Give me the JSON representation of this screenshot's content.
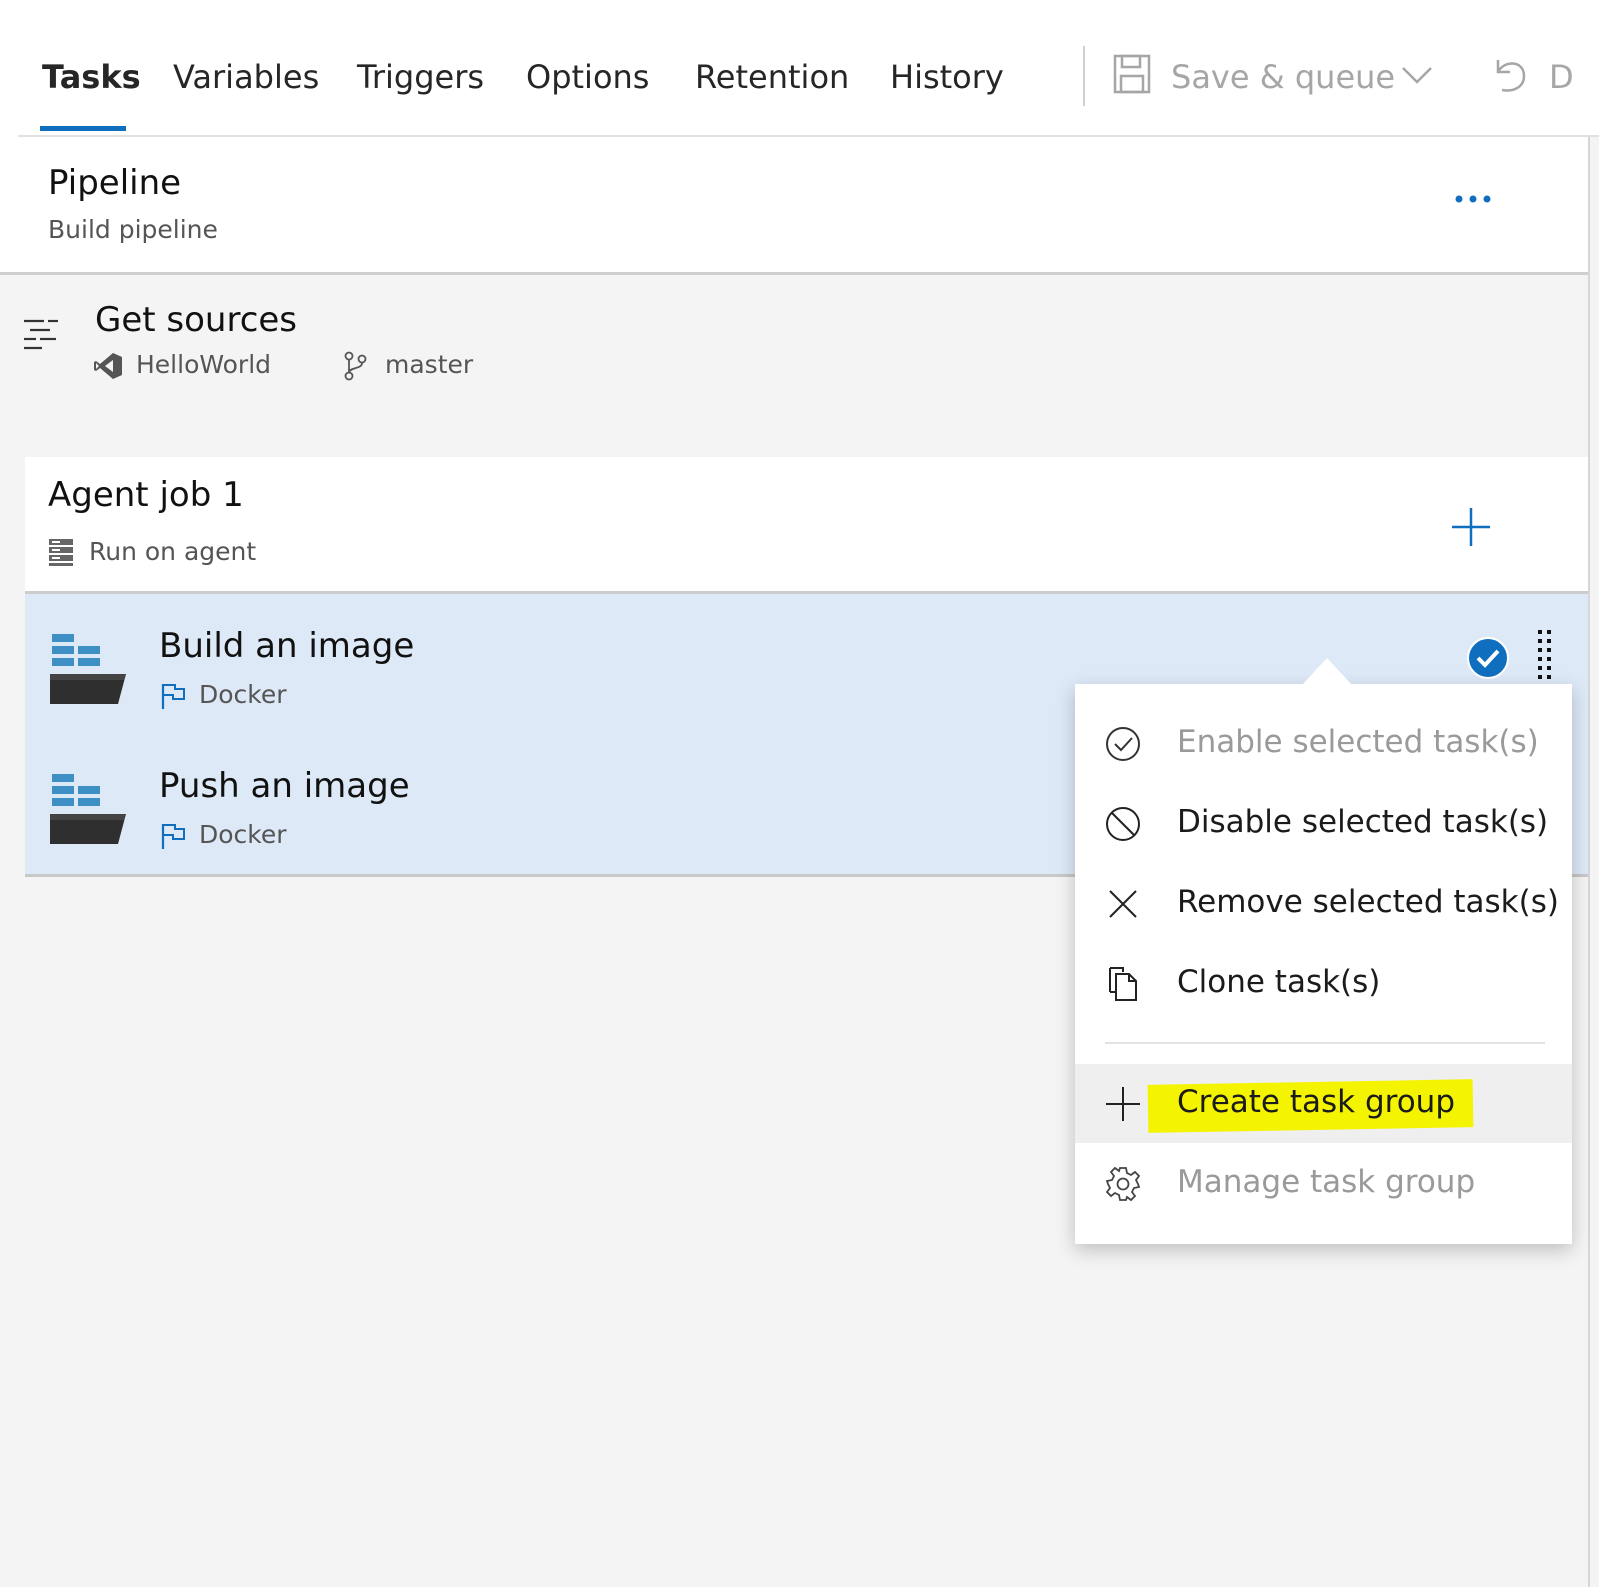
{
  "tabs": [
    {
      "label": "Tasks",
      "active": true
    },
    {
      "label": "Variables"
    },
    {
      "label": "Triggers"
    },
    {
      "label": "Options"
    },
    {
      "label": "Retention"
    },
    {
      "label": "History"
    }
  ],
  "toolbar": {
    "save_queue_label": "Save & queue",
    "discard_label": "D"
  },
  "pipeline": {
    "title": "Pipeline",
    "subtitle": "Build pipeline",
    "more_label": "..."
  },
  "get_sources": {
    "title": "Get sources",
    "repo": "HelloWorld",
    "branch": "master"
  },
  "agent_job": {
    "title": "Agent job 1",
    "subtitle": "Run on agent"
  },
  "tasks": [
    {
      "title": "Build an image",
      "subtitle": "Docker",
      "selected": true
    },
    {
      "title": "Push an image",
      "subtitle": "Docker",
      "selected": true
    }
  ],
  "context_menu": {
    "items": [
      {
        "label": "Enable selected task(s)",
        "icon": "check-circle-icon",
        "enabled": false
      },
      {
        "label": "Disable selected task(s)",
        "icon": "block-icon",
        "enabled": true
      },
      {
        "label": "Remove selected task(s)",
        "icon": "close-icon",
        "enabled": true
      },
      {
        "label": "Clone task(s)",
        "icon": "copy-icon",
        "enabled": true
      },
      {
        "label": "Create task group",
        "icon": "plus-icon",
        "enabled": true,
        "highlighted": true
      },
      {
        "label": "Manage task group",
        "icon": "gear-icon",
        "enabled": false
      }
    ]
  },
  "colors": {
    "accent": "#106ebe",
    "selected_row": "#dde9f7",
    "highlight": "#f4f400"
  }
}
